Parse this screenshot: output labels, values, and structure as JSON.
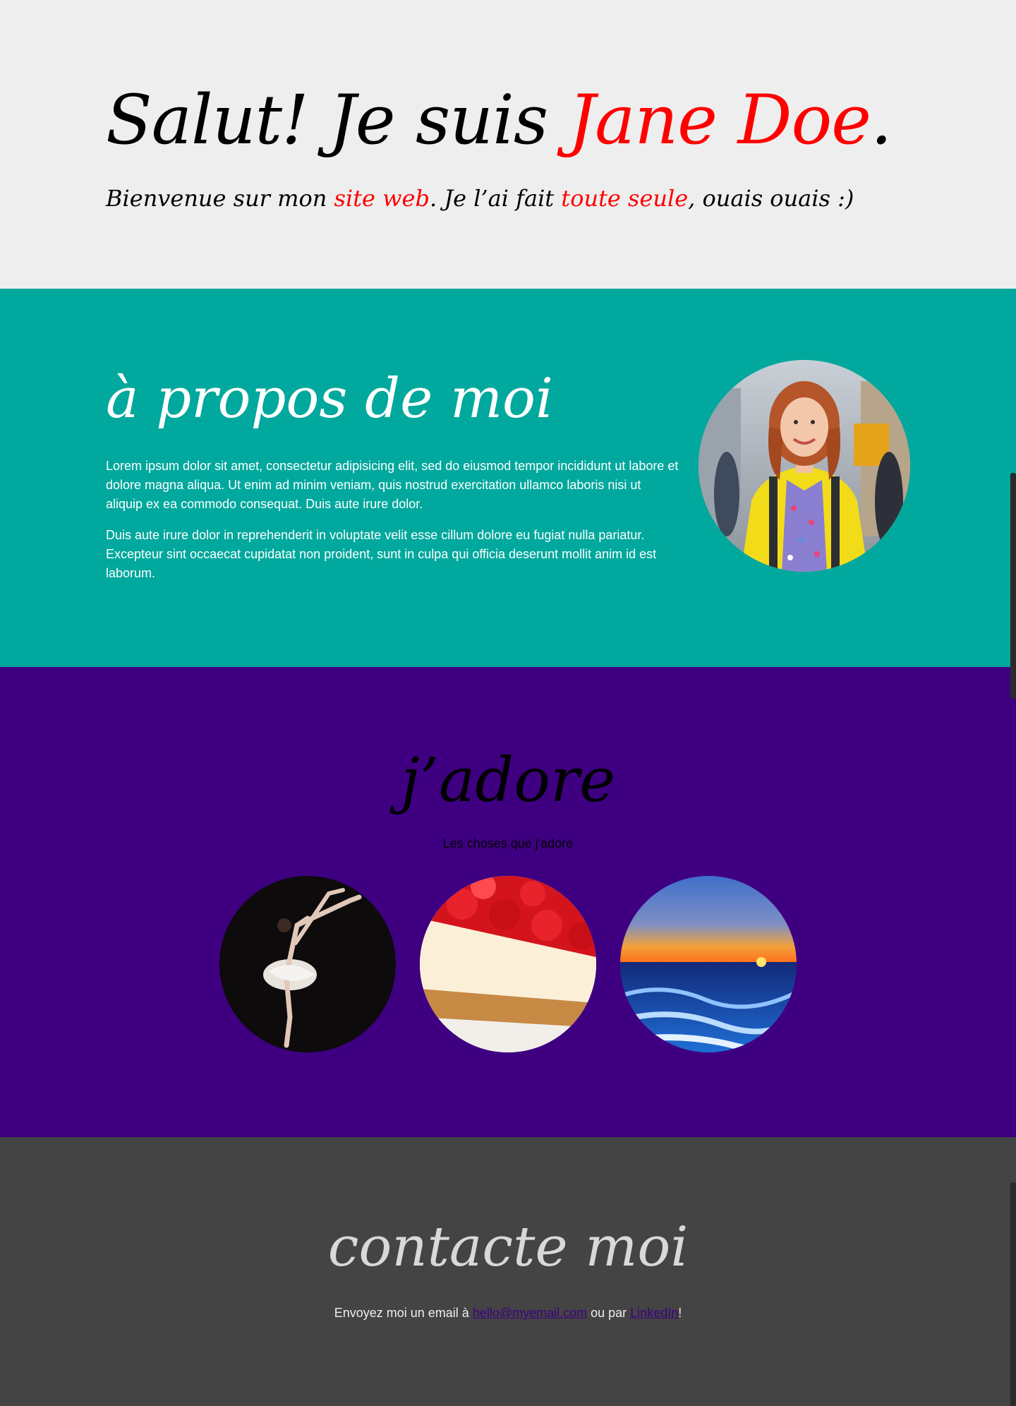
{
  "hero": {
    "title_prefix": "Salut! Je suis ",
    "title_name": "Jane Doe",
    "title_suffix": ".",
    "sub_part1": "Bienvenue sur mon ",
    "sub_link1": "site web",
    "sub_part2": ". Je l’ai fait ",
    "sub_link2": "toute seule",
    "sub_part3": ", ouais ouais :)"
  },
  "about": {
    "title": "à propos de moi",
    "paragraph1": "Lorem ipsum dolor sit amet, consectetur adipisicing elit, sed do eiusmod tempor incididunt ut labore et dolore magna aliqua. Ut enim ad minim veniam, quis nostrud exercitation ullamco laboris nisi ut aliquip ex ea commodo consequat. Duis aute irure dolor.",
    "paragraph2": "Duis aute irure dolor in reprehenderit in voluptate velit esse cillum dolore eu fugiat nulla pariatur. Excepteur sint occaecat cupidatat non proident, sunt in culpa qui officia deserunt mollit anim id est laborum."
  },
  "loves": {
    "title": "j’adore",
    "subtitle": "Les choses que j'adore"
  },
  "contact": {
    "title": "contacte moi",
    "text_before": "Envoyez moi un email à ",
    "email": "hello@myemail.com",
    "text_middle": " ou par ",
    "linkedin": "LinkedIn",
    "text_after": "!"
  },
  "colors": {
    "hero_bg": "#eeeeee",
    "accent": "#ff0000",
    "about_bg": "#00a89d",
    "loves_bg": "#3e0081",
    "contact_bg": "#444444"
  }
}
